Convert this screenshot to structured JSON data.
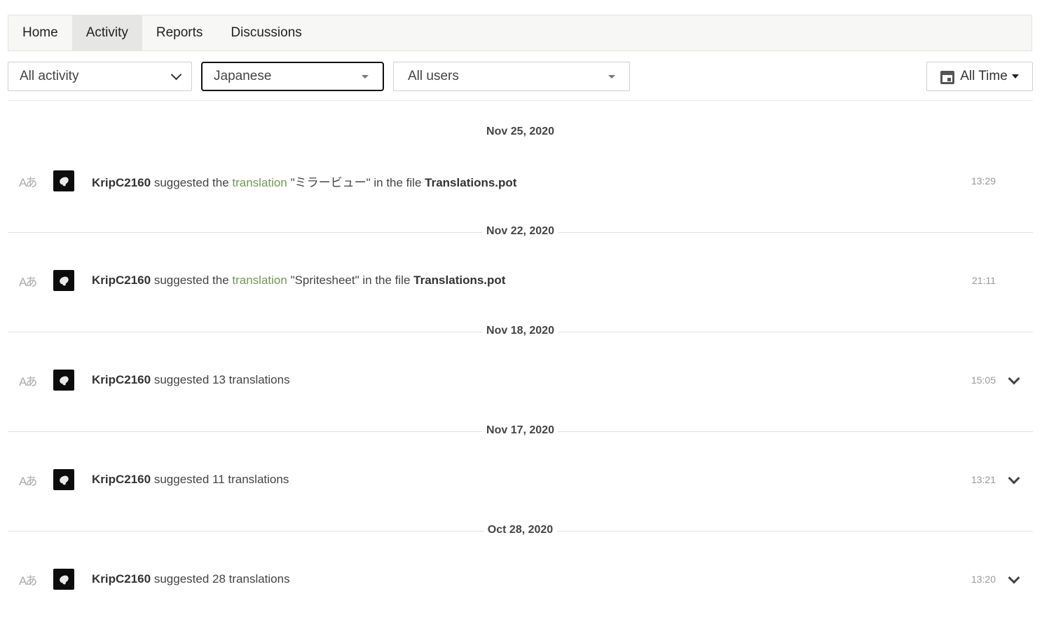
{
  "tabs": [
    {
      "label": "Home"
    },
    {
      "label": "Activity"
    },
    {
      "label": "Reports"
    },
    {
      "label": "Discussions"
    }
  ],
  "filters": {
    "activity": "All activity",
    "language": "Japanese",
    "users": "All users",
    "time": "All Time"
  },
  "groups": [
    {
      "date": "Nov 25, 2020",
      "entry": {
        "user": "KripC2160",
        "verb": "suggested the",
        "link": "translation",
        "quote": "\"ミラービュー\"",
        "in_file": "in the file",
        "file": "Translations.pot",
        "time": "13:29"
      }
    },
    {
      "date": "Nov 22, 2020",
      "entry": {
        "user": "KripC2160",
        "verb": "suggested the",
        "link": "translation",
        "quote": "\"Spritesheet\"",
        "in_file": "in the file",
        "file": "Translations.pot",
        "time": "21:11"
      }
    },
    {
      "date": "Nov 18, 2020",
      "entry": {
        "user": "KripC2160",
        "summary": "suggested 13 translations",
        "time": "15:05"
      }
    },
    {
      "date": "Nov 17, 2020",
      "entry": {
        "user": "KripC2160",
        "summary": "suggested 11 translations",
        "time": "13:21"
      }
    },
    {
      "date": "Oct 28, 2020",
      "entry": {
        "user": "KripC2160",
        "summary": "suggested 28 translations",
        "time": "13:20"
      }
    }
  ],
  "icons": {
    "translation": "translate-icon",
    "calendar": "calendar-icon",
    "expand": "chevron-down-icon"
  },
  "colors": {
    "link": "#6f9a55",
    "active_tab": "#e6e6e4",
    "avatar": "#0c0c0c"
  }
}
